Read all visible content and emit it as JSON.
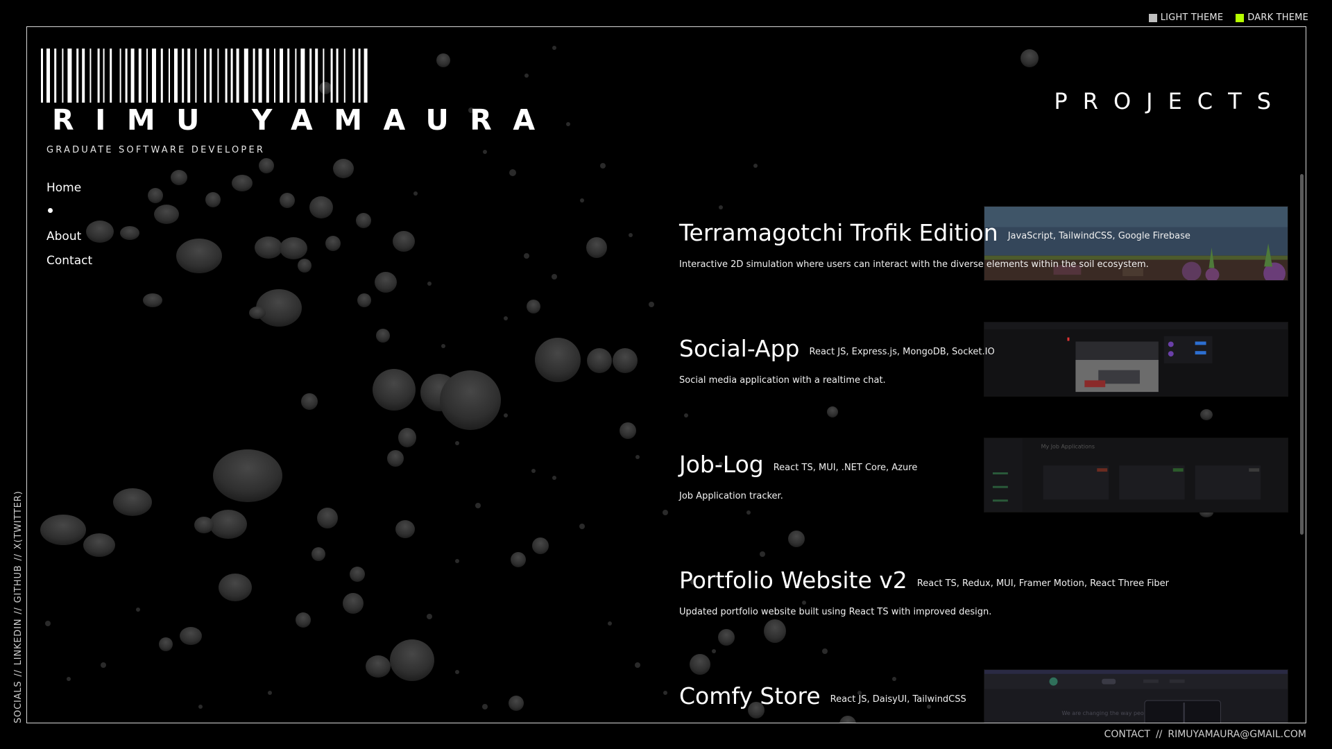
{
  "theme": {
    "light_label": "LIGHT THEME",
    "dark_label": "DARK THEME",
    "light_color": "#bfbfbf",
    "dark_color": "#b6ff00"
  },
  "header": {
    "name": "RIMU YAMAURA",
    "subtitle": "GRADUATE SOFTWARE DEVELOPER"
  },
  "nav": {
    "home": "Home",
    "about": "About",
    "contact": "Contact"
  },
  "section_title": "PROJECTS",
  "projects": [
    {
      "title": "Terramagotchi Trofik Edition",
      "tech": "JavaScript, TailwindCSS, Google Firebase",
      "desc": "Interactive 2D simulation where users can interact with the diverse elements within the soil ecosystem."
    },
    {
      "title": "Social-App",
      "tech": "React JS, Express.js, MongoDB, Socket.IO",
      "desc": "Social media application with a realtime chat."
    },
    {
      "title": "Job-Log",
      "tech": "React TS, MUI, .NET Core, Azure",
      "desc": "Job Application tracker.",
      "thumb_text": "My Job Applications"
    },
    {
      "title": "Portfolio Website v2",
      "tech": "React TS, Redux, MUI, Framer Motion, React Three Fiber",
      "desc": "Updated portfolio website built using React TS with improved design."
    },
    {
      "title": "Comfy Store",
      "tech": "React JS, DaisyUI, TailwindCSS",
      "thumb_text": "We are changing the way people shop"
    }
  ],
  "socials": {
    "label": "SOCIALS",
    "sep": "//",
    "linkedin": "LINKEDIN",
    "github": "GITHUB",
    "twitter": "X(TWITTER)"
  },
  "footer": {
    "contact_label": "CONTACT",
    "sep": "//",
    "email": "RIMUYAMAURA@GMAIL.COM"
  }
}
